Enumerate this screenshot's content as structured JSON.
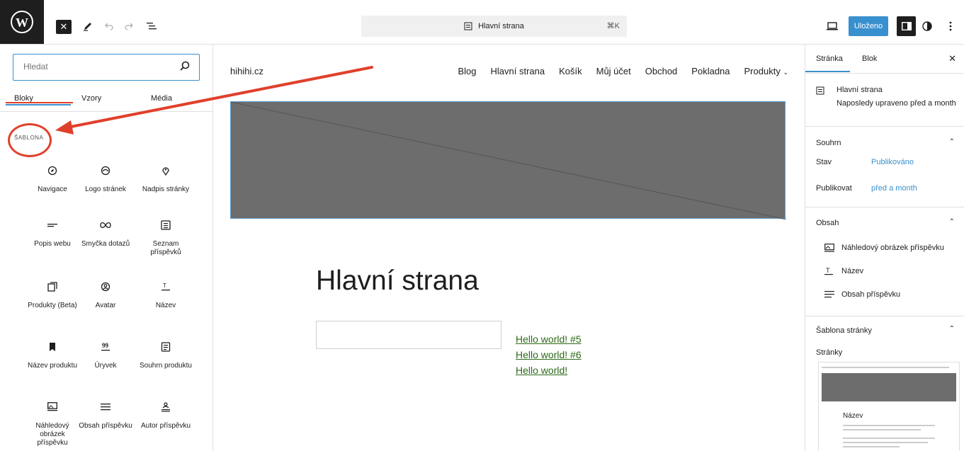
{
  "topbar": {
    "command_title": "Hlavní strana",
    "command_shortcut": "⌘K",
    "saved_label": "Uloženo"
  },
  "inserter": {
    "search_placeholder": "Hledat",
    "tabs": [
      "Bloky",
      "Vzory",
      "Média"
    ],
    "category": "Šablona",
    "blocks": [
      {
        "label": "Navigace",
        "icon": "compass-icon"
      },
      {
        "label": "Logo stránek",
        "icon": "site-logo-icon"
      },
      {
        "label": "Nadpis stránky",
        "icon": "map-marker-icon"
      },
      {
        "label": "Popis webu",
        "icon": "site-tagline-icon"
      },
      {
        "label": "Smyčka dotazů",
        "icon": "loop-icon"
      },
      {
        "label": "Seznam příspěvků",
        "icon": "post-list-icon"
      },
      {
        "label": "Produkty (Beta)",
        "icon": "product-collection-icon"
      },
      {
        "label": "Avatar",
        "icon": "avatar-icon"
      },
      {
        "label": "Název",
        "icon": "title-icon"
      },
      {
        "label": "Název produktu",
        "icon": "bookmark-icon"
      },
      {
        "label": "Úryvek",
        "icon": "excerpt-icon"
      },
      {
        "label": "Souhrn produktu",
        "icon": "summary-icon"
      },
      {
        "label": "Náhledový obrázek příspěvku",
        "icon": "featured-image-icon"
      },
      {
        "label": "Obsah příspěvku",
        "icon": "content-icon"
      },
      {
        "label": "Autor příspěvku",
        "icon": "author-icon"
      }
    ]
  },
  "canvas": {
    "site_title": "hihihi.cz",
    "nav": [
      "Blog",
      "Hlavní strana",
      "Košík",
      "Můj účet",
      "Obchod",
      "Pokladna",
      "Produkty"
    ],
    "page_heading": "Hlavní strana",
    "links": [
      "Hello world! #5",
      "Hello world! #6",
      "Hello world!"
    ]
  },
  "sidebar": {
    "tabs": [
      "Stránka",
      "Blok"
    ],
    "page_name": "Hlavní strana",
    "page_modified": "Naposledy upraveno před a month",
    "summary_title": "Souhrn",
    "status_label": "Stav",
    "status_value": "Publikováno",
    "publish_label": "Publikovat",
    "publish_value": "před a month",
    "content_title": "Obsah",
    "content_items": [
      "Náhledový obrázek příspěvku",
      "Název",
      "Obsah příspěvku"
    ],
    "template_title": "Šablona stránky",
    "template_value": "Stránky",
    "thumb_title": "Název"
  },
  "colors": {
    "accent": "#3990cf",
    "annotation": "#e0402b"
  }
}
